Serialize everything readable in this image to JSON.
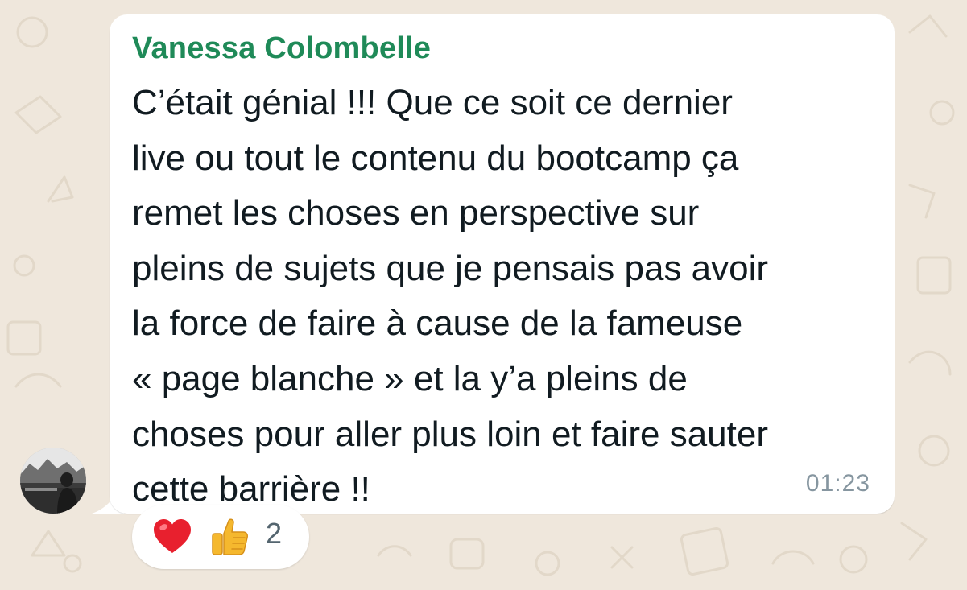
{
  "message": {
    "sender_name": "Vanessa Colombelle",
    "lines": [
      "C’était génial !!! Que ce soit ce dernier",
      "live ou tout le contenu du bootcamp ça",
      "remet les choses en perspective sur",
      "pleins de sujets que je pensais pas avoir",
      "la force de faire à cause de la fameuse",
      "« page blanche » et la y’a pleins de",
      "choses pour aller plus loin et faire sauter",
      "cette barrière !!"
    ],
    "time": "01:23"
  },
  "reactions": {
    "items": [
      {
        "icon": "red-heart-icon"
      },
      {
        "icon": "thumbs-up-icon"
      }
    ],
    "count": "2"
  },
  "colors": {
    "wallpaper": "#efe7dc",
    "sender_name": "#1f8a58",
    "bubble": "#ffffff",
    "message_text": "#111b21",
    "time": "#8696a0",
    "heart": "#e8202e",
    "thumb": "#f5b82e"
  }
}
